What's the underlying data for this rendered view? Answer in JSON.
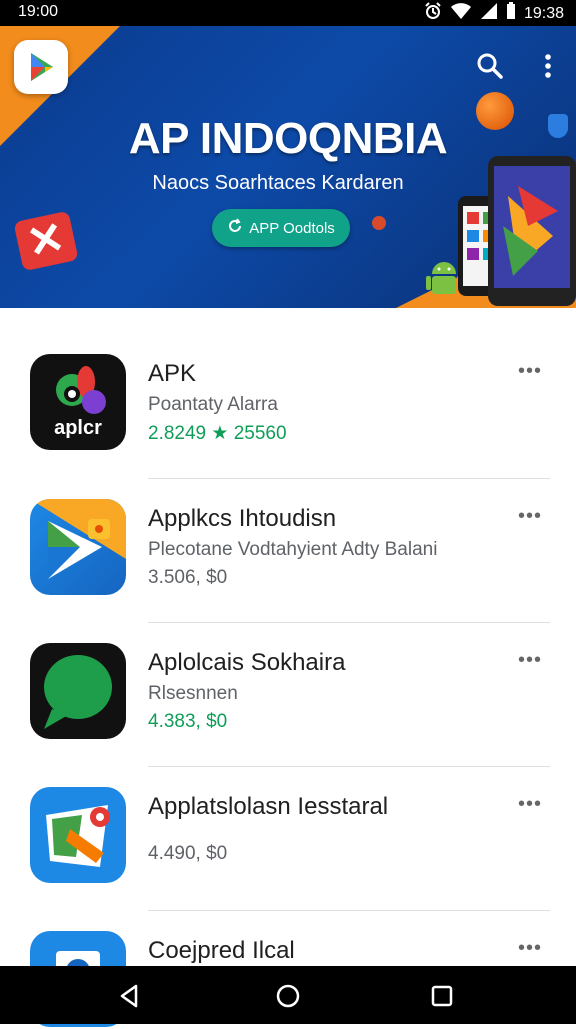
{
  "status_bar": {
    "time_left": "19:00",
    "time_right": "19:38"
  },
  "header": {
    "title": "AP INDOQNBIA",
    "subtitle": "Naocs Soarhtaces Kardaren",
    "cta_label": "APP Oodtols",
    "accent_color": "#10a38a",
    "brand_color": "#0d4aa8"
  },
  "apps": [
    {
      "name": "APK",
      "subtitle": "Poantaty Alarra",
      "meta": "2.8249 ★ 25560",
      "meta_color": "green",
      "icon": "apk-app-icon"
    },
    {
      "name": "Applkcs Ihtoudisn",
      "subtitle": "Plecotane Vodtahyient Adty Balani",
      "meta": "3.506, $0",
      "meta_color": "gray",
      "icon": "play-store-app-icon"
    },
    {
      "name": "Aplolcais Sokhaira",
      "subtitle": "Rlsesnnen",
      "meta": "4.383, $0",
      "meta_color": "green",
      "icon": "chat-bubble-app-icon"
    },
    {
      "name": "Applatslolasn Iesstaral",
      "subtitle": "",
      "meta": "4.490, $0",
      "meta_color": "gray",
      "icon": "map-app-icon"
    },
    {
      "name": "Coejpred Ilcal",
      "subtitle": "",
      "meta": "",
      "meta_color": "gray",
      "icon": "partial-app-icon"
    }
  ],
  "nav": {
    "back": "back-icon",
    "home": "home-icon",
    "recents": "recents-icon"
  }
}
